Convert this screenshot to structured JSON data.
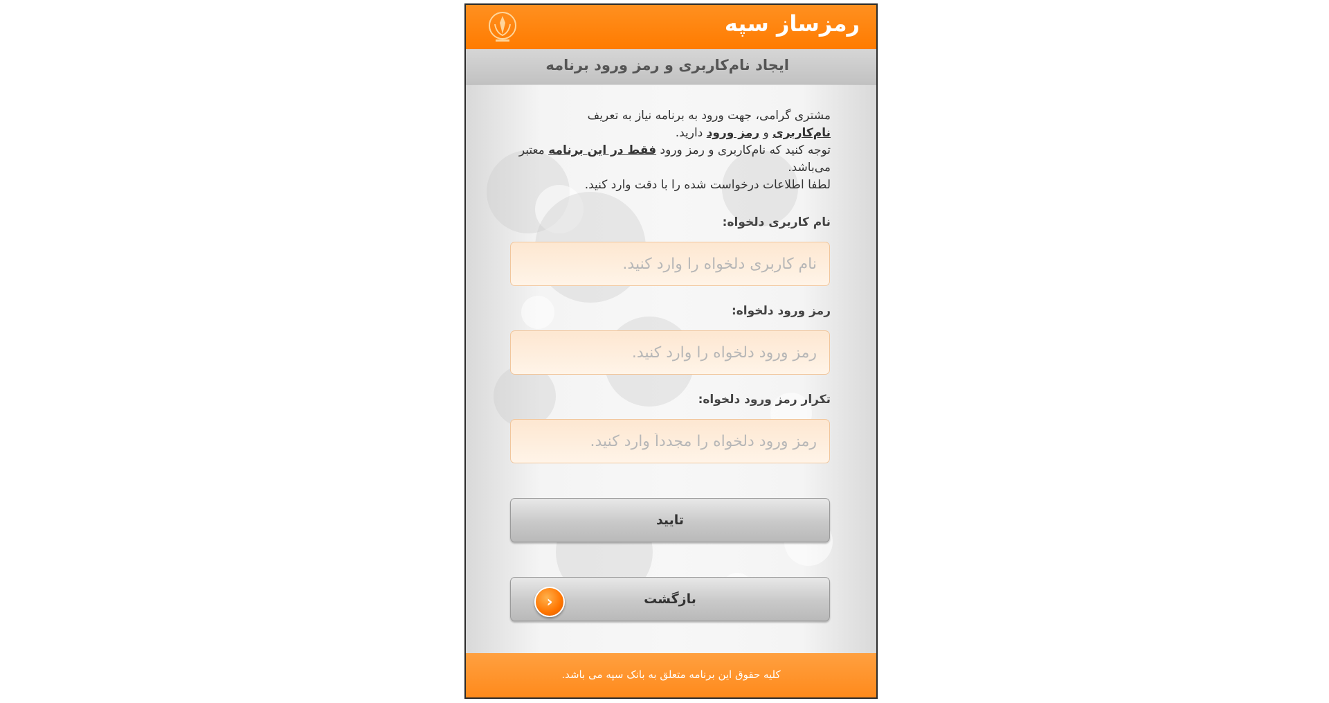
{
  "app": {
    "title": "رمزساز سپه"
  },
  "header": {
    "subtitle": "ایجاد نام‌کاربری و رمز ورود برنامه"
  },
  "intro": {
    "line1": "مشتری گرامی، جهت ورود به برنامه نیاز به تعریف",
    "username_term": "نام‌کاربری",
    "and": " و ",
    "password_term": "رمز ورود",
    "line2_tail": " دارید.",
    "line3": "توجه کنید که نام‌کاربری و رمز ورود ",
    "only_in_this": "فقط در این برنامه",
    "line3_tail": " معتبر می‌باشد.",
    "line4": "لطفا اطلاعات درخواست شده را با دقت وارد کنید."
  },
  "form": {
    "username_label": "نام کاربری دلخواه:",
    "username_placeholder": "نام کاربری دلخواه را وارد کنید.",
    "username_value": "",
    "password_label": "رمز ورود دلخواه:",
    "password_placeholder": "رمز ورود دلخواه را وارد کنید.",
    "password_value": "",
    "confirm_label": "تکرار رمز ورود دلخواه:",
    "confirm_placeholder": "رمز ورود دلخواه را مجدداً وارد کنید.",
    "confirm_value": ""
  },
  "buttons": {
    "confirm": "تایید",
    "back": "بازگشت"
  },
  "icons": {
    "emblem": "bank-sepah-emblem-icon",
    "back": "chevron-left-circle-icon"
  },
  "footer": {
    "copyright": "کلیه حقوق این برنامه متعلق به بانک سپه می باشد."
  },
  "colors": {
    "accent": "#ff7b00",
    "subheader": "#c9c9c9"
  }
}
